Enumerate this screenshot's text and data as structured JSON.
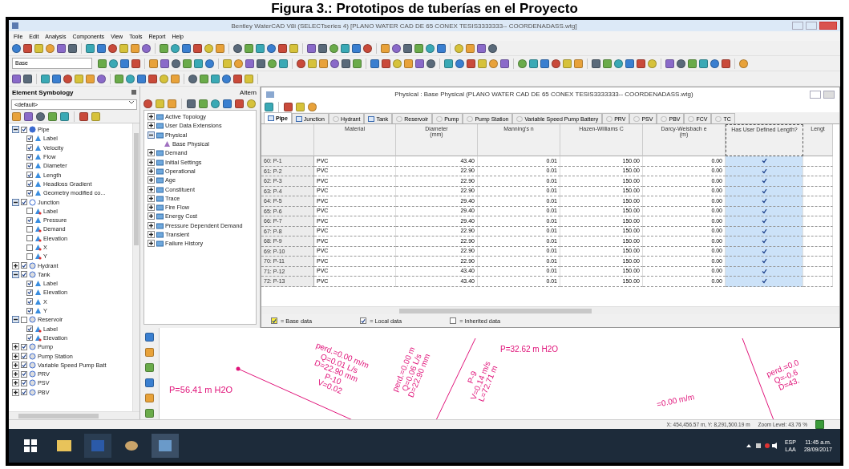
{
  "caption": "Figura 3.: Prototipos de tuberías en el Proyecto",
  "window": {
    "title": "Bentley WaterCAD V8i (SELECTseries 4) [PLANO WATER CAD DE 65 CONEX TESIS3333333-- COORDENADASS.wtg]"
  },
  "menu": [
    "File",
    "Edit",
    "Analysis",
    "Components",
    "View",
    "Tools",
    "Report",
    "Help"
  ],
  "scenario_dropdown": "Base",
  "symbology": {
    "title": "Element Symbology",
    "dropdown": "<default>",
    "items": [
      {
        "label": "Pipe",
        "checked": true,
        "expanded": true,
        "children": [
          {
            "label": "Label",
            "checked": true
          },
          {
            "label": "Velocity",
            "checked": true
          },
          {
            "label": "Flow",
            "checked": true
          },
          {
            "label": "Diameter",
            "checked": true
          },
          {
            "label": "Length",
            "checked": true
          },
          {
            "label": "Headloss Gradient",
            "checked": true
          },
          {
            "label": "Geometry modified co...",
            "checked": true
          }
        ]
      },
      {
        "label": "Junction",
        "checked": true,
        "expanded": true,
        "children": [
          {
            "label": "Label",
            "checked": false
          },
          {
            "label": "Pressure",
            "checked": true
          },
          {
            "label": "Demand",
            "checked": false
          },
          {
            "label": "Elevation",
            "checked": false
          },
          {
            "label": "X",
            "checked": false
          },
          {
            "label": "Y",
            "checked": false
          }
        ]
      },
      {
        "label": "Hydrant",
        "checked": true,
        "expanded": false
      },
      {
        "label": "Tank",
        "checked": true,
        "expanded": true,
        "children": [
          {
            "label": "Label",
            "checked": true
          },
          {
            "label": "Elevation",
            "checked": true
          },
          {
            "label": "X",
            "checked": true
          },
          {
            "label": "Y",
            "checked": true
          }
        ]
      },
      {
        "label": "Reservoir",
        "checked": false,
        "expanded": true,
        "children": [
          {
            "label": "Label",
            "checked": true
          },
          {
            "label": "Elevation",
            "checked": true
          }
        ]
      },
      {
        "label": "Pump",
        "checked": true,
        "expanded": false
      },
      {
        "label": "Pump Station",
        "checked": true,
        "expanded": false
      },
      {
        "label": "Variable Speed Pump Batt",
        "checked": true,
        "expanded": false
      },
      {
        "label": "PRV",
        "checked": true,
        "expanded": false
      },
      {
        "label": "PSV",
        "checked": true,
        "expanded": false
      },
      {
        "label": "PBV",
        "checked": true,
        "expanded": false
      }
    ]
  },
  "alternatives": {
    "title": "Altern",
    "items": [
      {
        "label": "Active Topology",
        "expanded": false
      },
      {
        "label": "User Data Extensions",
        "expanded": false
      },
      {
        "label": "Physical",
        "expanded": true,
        "children": [
          {
            "label": "Base Physical"
          }
        ]
      },
      {
        "label": "Demand",
        "expanded": false
      },
      {
        "label": "Initial Settings",
        "expanded": false
      },
      {
        "label": "Operational",
        "expanded": false
      },
      {
        "label": "Age",
        "expanded": false
      },
      {
        "label": "Constituent",
        "expanded": false
      },
      {
        "label": "Trace",
        "expanded": false
      },
      {
        "label": "Fire Flow",
        "expanded": false
      },
      {
        "label": "Energy Cost",
        "expanded": false
      },
      {
        "label": "Pressure Dependent Demand",
        "expanded": false
      },
      {
        "label": "Transient",
        "expanded": false
      },
      {
        "label": "Failure History",
        "expanded": false
      }
    ]
  },
  "table_window": {
    "title": "Physical : Base Physical (PLANO WATER CAD DE 65 CONEX TESIS3333333-- COORDENADASS.wtg)",
    "tabs": [
      {
        "label": "Pipe",
        "selected": true
      },
      {
        "label": "Junction",
        "selected": false
      },
      {
        "label": "Hydrant",
        "selected": false
      },
      {
        "label": "Tank",
        "selected": false
      },
      {
        "label": "Reservoir",
        "selected": false
      },
      {
        "label": "Pump",
        "selected": false
      },
      {
        "label": "Pump Station",
        "selected": false
      },
      {
        "label": "Variable Speed Pump Battery",
        "selected": false
      },
      {
        "label": "PRV",
        "selected": false
      },
      {
        "label": "PSV",
        "selected": false
      },
      {
        "label": "PBV",
        "selected": false
      },
      {
        "label": "FCV",
        "selected": false
      },
      {
        "label": "TC",
        "selected": false
      }
    ],
    "columns": [
      "Material",
      "Diameter\n(mm)",
      "Manning's n",
      "Hazen-Williams C",
      "Darcy-Weisbach e\n(m)",
      "Has User Defined Length?",
      "Lengt"
    ],
    "rows": [
      {
        "id": "60: P-1",
        "material": "PVC",
        "diameter": "43.40",
        "manning": "0.01",
        "hazen": "150.00",
        "darcy": "0.00",
        "user_length": true
      },
      {
        "id": "61: P-2",
        "material": "PVC",
        "diameter": "22.90",
        "manning": "0.01",
        "hazen": "150.00",
        "darcy": "0.00",
        "user_length": true
      },
      {
        "id": "62: P-3",
        "material": "PVC",
        "diameter": "22.90",
        "manning": "0.01",
        "hazen": "150.00",
        "darcy": "0.00",
        "user_length": true
      },
      {
        "id": "63: P-4",
        "material": "PVC",
        "diameter": "22.90",
        "manning": "0.01",
        "hazen": "150.00",
        "darcy": "0.00",
        "user_length": true
      },
      {
        "id": "64: P-5",
        "material": "PVC",
        "diameter": "29.40",
        "manning": "0.01",
        "hazen": "150.00",
        "darcy": "0.00",
        "user_length": true
      },
      {
        "id": "65: P-6",
        "material": "PVC",
        "diameter": "29.40",
        "manning": "0.01",
        "hazen": "150.00",
        "darcy": "0.00",
        "user_length": true
      },
      {
        "id": "66: P-7",
        "material": "PVC",
        "diameter": "29.40",
        "manning": "0.01",
        "hazen": "150.00",
        "darcy": "0.00",
        "user_length": true
      },
      {
        "id": "67: P-8",
        "material": "PVC",
        "diameter": "22.90",
        "manning": "0.01",
        "hazen": "150.00",
        "darcy": "0.00",
        "user_length": true
      },
      {
        "id": "68: P-9",
        "material": "PVC",
        "diameter": "22.90",
        "manning": "0.01",
        "hazen": "150.00",
        "darcy": "0.00",
        "user_length": true
      },
      {
        "id": "69: P-10",
        "material": "PVC",
        "diameter": "22.90",
        "manning": "0.01",
        "hazen": "150.00",
        "darcy": "0.00",
        "user_length": true
      },
      {
        "id": "70: P-11",
        "material": "PVC",
        "diameter": "22.90",
        "manning": "0.01",
        "hazen": "150.00",
        "darcy": "0.00",
        "user_length": true
      },
      {
        "id": "71: P-12",
        "material": "PVC",
        "diameter": "43.40",
        "manning": "0.01",
        "hazen": "150.00",
        "darcy": "0.00",
        "user_length": true
      },
      {
        "id": "72: P-13",
        "material": "PVC",
        "diameter": "43.40",
        "manning": "0.01",
        "hazen": "150.00",
        "darcy": "0.00",
        "user_length": true
      }
    ],
    "legend": [
      {
        "label": "= Base data",
        "checked": true
      },
      {
        "label": "= Local data",
        "checked": true
      },
      {
        "label": "= Inherited data",
        "checked": false
      }
    ]
  },
  "map_labels": [
    {
      "lines": [
        "P=56.41 m H2O"
      ]
    },
    {
      "lines": [
        "perd.=0.00 m/m",
        "Q=0.01 L/s",
        "D=22.90 mm",
        "P-10",
        "V=0.02"
      ]
    },
    {
      "lines": [
        "perd.=0.00 m",
        "Q=0.06 L/s",
        "D=22.90 mm"
      ]
    },
    {
      "lines": [
        "P-9",
        "V=0.14 m/s",
        "L=72.71 m"
      ]
    },
    {
      "lines": [
        "P=32.62 m H2O"
      ]
    },
    {
      "lines": [
        "=0.00 m/m"
      ]
    },
    {
      "lines": [
        "perd.=0.0",
        "Q=-0.6",
        "D=43."
      ]
    }
  ],
  "status_bar": {
    "coordinates": "X: 454,456.57 m, Y: 8,291,500.19 m",
    "zoom": "Zoom Level: 43.76 %"
  },
  "taskbar": {
    "language": "ESP",
    "layout": "LAA",
    "time": "11:45 a.m.",
    "date": "28/09/2017"
  }
}
